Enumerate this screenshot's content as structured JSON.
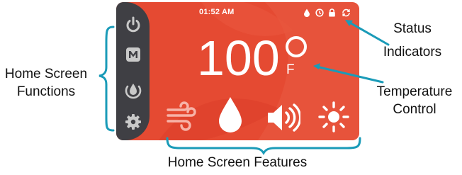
{
  "labels": {
    "home_functions_line1": "Home Screen",
    "home_functions_line2": "Functions",
    "status_line1": "Status",
    "status_line2": "Indicators",
    "temp_line1": "Temperature",
    "temp_line2": "Control",
    "features": "Home Screen Features"
  },
  "screen": {
    "time": "01:52 AM",
    "temperature": "100",
    "unit": "F"
  },
  "icons": {
    "sidebar": [
      "power-icon",
      "m-mode-icon",
      "eco-drop-icon",
      "settings-gear-icon"
    ],
    "status": [
      "water-drop-icon",
      "timer-icon",
      "lock-icon",
      "sync-icon"
    ],
    "features": [
      "steam-wind-icon",
      "water-drop-icon",
      "speaker-volume-icon",
      "sun-light-icon"
    ]
  },
  "colors": {
    "screen_bg": "#e54a32",
    "sidebar_bg": "#3f3f44",
    "annotation": "#1a9bb8",
    "icon_white": "#ffffff",
    "icon_pink": "#f7b3a8"
  }
}
